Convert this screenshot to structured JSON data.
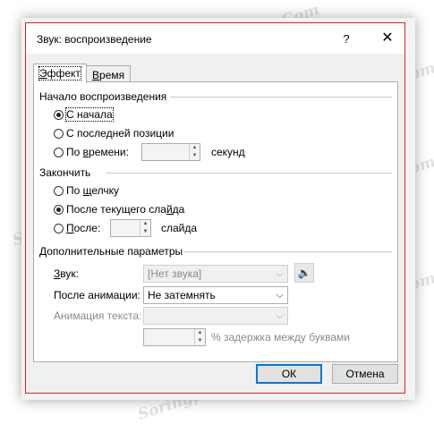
{
  "dialog": {
    "title": "Звук: воспроизведение",
    "help_glyph": "?",
    "close_glyph": "✕"
  },
  "tabs": [
    {
      "label_underlined": "Э",
      "label_rest": "ффект",
      "active": true
    },
    {
      "label_underlined": "В",
      "label_rest": "ремя",
      "active": false
    }
  ],
  "start_group": {
    "title": "Начало воспроизведения",
    "options": [
      {
        "label": "С начала",
        "selected": true
      },
      {
        "label": "С последней позиции",
        "selected": false
      },
      {
        "label_pre": "По ",
        "label_underlined": "в",
        "label_post": "ремени:",
        "selected": false
      }
    ],
    "time_value": "",
    "time_unit": "секунд"
  },
  "stop_group": {
    "title": "Закончить",
    "options": [
      {
        "label_pre": "По ",
        "label_underlined": "щ",
        "label_post": "елчку",
        "selected": false
      },
      {
        "label_pre": "После текущего сла",
        "label_underlined": "й",
        "label_post": "да",
        "selected": true
      },
      {
        "label_pre": "",
        "label_underlined": "П",
        "label_post": "осле:",
        "selected": false
      }
    ],
    "after_value": "",
    "after_unit": "слайда"
  },
  "advanced_group": {
    "title": "Дополнительные параметры",
    "sound_label_underlined": "З",
    "sound_label_rest": "вук:",
    "sound_value": "[Нет звука]",
    "after_anim_label": "После анимации:",
    "after_anim_value": "Не затемнять",
    "text_anim_label": "Анимация текста:",
    "text_anim_value": "",
    "delay_value": "",
    "delay_label": "% задержка между буквами"
  },
  "buttons": {
    "ok": "ОК",
    "cancel": "Отмена"
  },
  "watermark": "Soringpcrepair.Com",
  "icons": {
    "speaker": "speaker-icon"
  }
}
